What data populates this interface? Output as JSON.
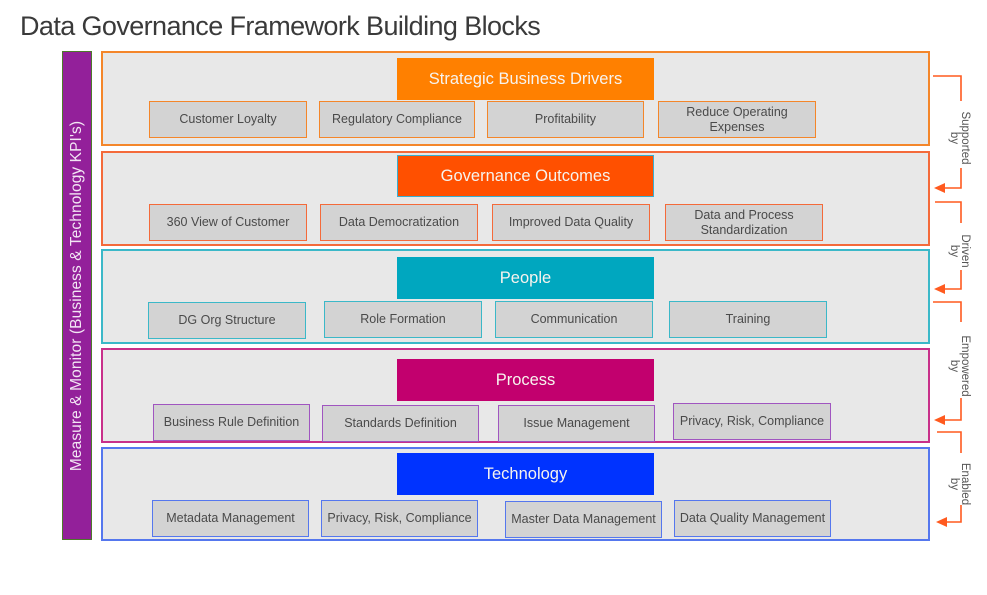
{
  "title": "Data Governance Framework Building Blocks",
  "side_bar": {
    "label": "Measure & Monitor (Business & Technology KPI's)",
    "color": "#93209a"
  },
  "layers": [
    {
      "heading": "Strategic Business Drivers",
      "heading_color": "#ff8000",
      "border_color": "#f4862a",
      "items": [
        "Customer Loyalty",
        "Regulatory Compliance",
        "Profitability",
        "Reduce Operating Expenses"
      ]
    },
    {
      "heading": "Governance Outcomes",
      "heading_color": "#ff5000",
      "border_color": "#f46a3a",
      "items": [
        "360 View of Customer",
        "Data Democratization",
        "Improved Data Quality",
        "Data and Process Standardization"
      ]
    },
    {
      "heading": "People",
      "heading_color": "#00a7bf",
      "border_color": "#3bb8c8",
      "items": [
        "DG Org Structure",
        "Role Formation",
        "Communication",
        "Training"
      ]
    },
    {
      "heading": "Process",
      "heading_color": "#c2006e",
      "border_color": "#c8308a",
      "items": [
        "Business Rule Definition",
        "Standards Definition",
        "Issue Management",
        "Privacy, Risk, Compliance"
      ]
    },
    {
      "heading": "Technology",
      "heading_color": "#0033ff",
      "border_color": "#5577ee",
      "items": [
        "Metadata Management",
        "Privacy, Risk, Compliance",
        "Master Data Management",
        "Data Quality Management"
      ]
    }
  ],
  "connectors": [
    {
      "label": "Supported by"
    },
    {
      "label": "Driven by"
    },
    {
      "label": "Empowered by"
    },
    {
      "label": "Enabled by"
    }
  ],
  "connector_color": "#ff5a1f"
}
